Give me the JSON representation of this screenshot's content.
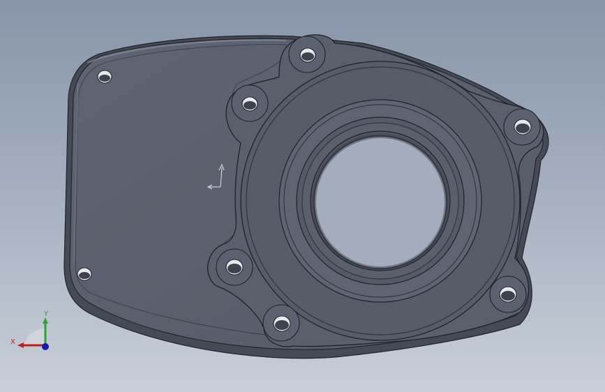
{
  "viewport": {
    "background_top": "#8795aa",
    "background_bottom": "#c9cfd8"
  },
  "model": {
    "face_color": "#5d6270",
    "edge_color": "#22252c",
    "side_color": "#4a4e5a",
    "highlight_color": "#8a8f9c",
    "bolt_holes": 8
  },
  "triad": {
    "x_label": "X",
    "y_label": "Y",
    "x_color": "#c0201c",
    "y_color": "#2ea12e",
    "z_color": "#1a1aa8"
  }
}
